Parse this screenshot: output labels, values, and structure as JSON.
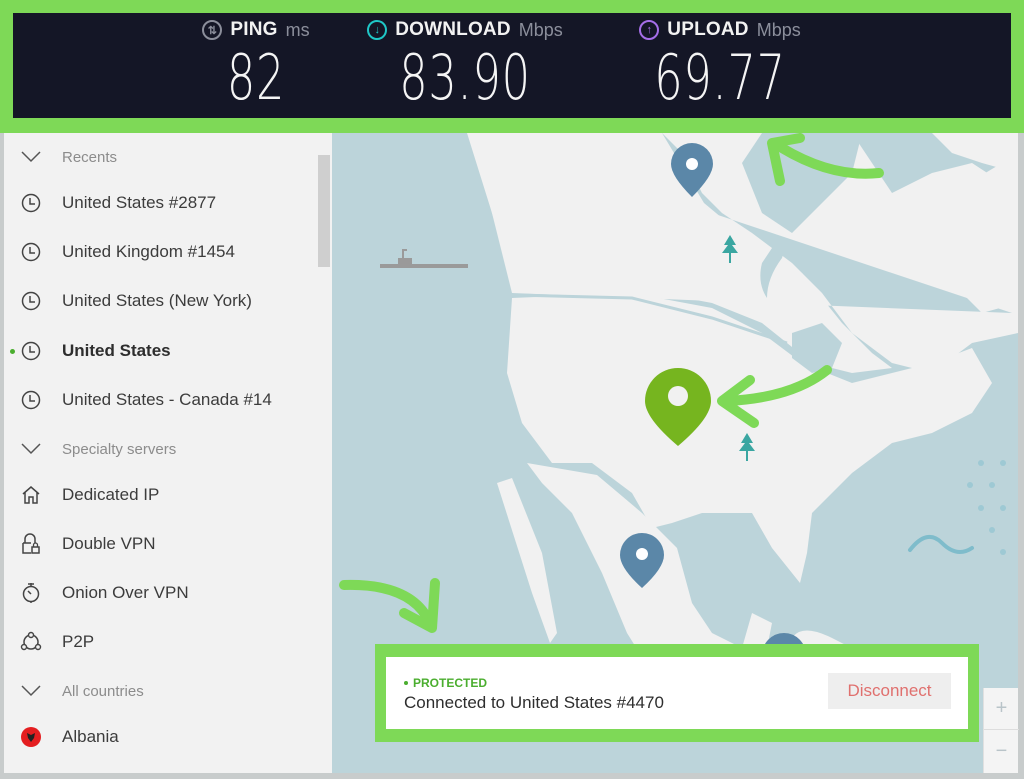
{
  "speed_test": {
    "ping": {
      "name": "PING",
      "unit": "ms",
      "value": "82",
      "icon": "ping-icon",
      "color": "#8b8e9b"
    },
    "download": {
      "name": "DOWNLOAD",
      "unit": "Mbps",
      "value": "83.90",
      "icon": "download-arrow-icon",
      "color": "#1fc7c7"
    },
    "upload": {
      "name": "UPLOAD",
      "unit": "Mbps",
      "value": "69.77",
      "icon": "upload-arrow-icon",
      "color": "#a56ee8"
    }
  },
  "sidebar": {
    "sections": [
      {
        "title": "Recents",
        "items": [
          {
            "label": "United States #2877",
            "icon": "clock-icon",
            "active": false
          },
          {
            "label": "United Kingdom #1454",
            "icon": "clock-icon",
            "active": false
          },
          {
            "label": "United States (New York)",
            "icon": "clock-icon",
            "active": false
          },
          {
            "label": "United States",
            "icon": "clock-icon",
            "active": true
          },
          {
            "label": "United States - Canada #14",
            "icon": "clock-icon",
            "active": false
          }
        ]
      },
      {
        "title": "Specialty servers",
        "items": [
          {
            "label": "Dedicated IP",
            "icon": "home-icon"
          },
          {
            "label": "Double VPN",
            "icon": "double-lock-icon"
          },
          {
            "label": "Onion Over VPN",
            "icon": "onion-icon"
          },
          {
            "label": "P2P",
            "icon": "p2p-icon"
          }
        ]
      },
      {
        "title": "All countries",
        "items": [
          {
            "label": "Albania",
            "icon": "albania-flag-icon"
          }
        ]
      }
    ]
  },
  "connection": {
    "status": "PROTECTED",
    "text": "Connected to United States #4470",
    "disconnect_label": "Disconnect"
  },
  "zoom_controls": {
    "zoom_in": "+",
    "zoom_out": "−"
  },
  "colors": {
    "highlight": "#7ed957",
    "connected_pin": "#76b51f",
    "server_pin": "#5b87a8",
    "protected": "#4bae2f",
    "disconnect_text": "#e0706e"
  }
}
